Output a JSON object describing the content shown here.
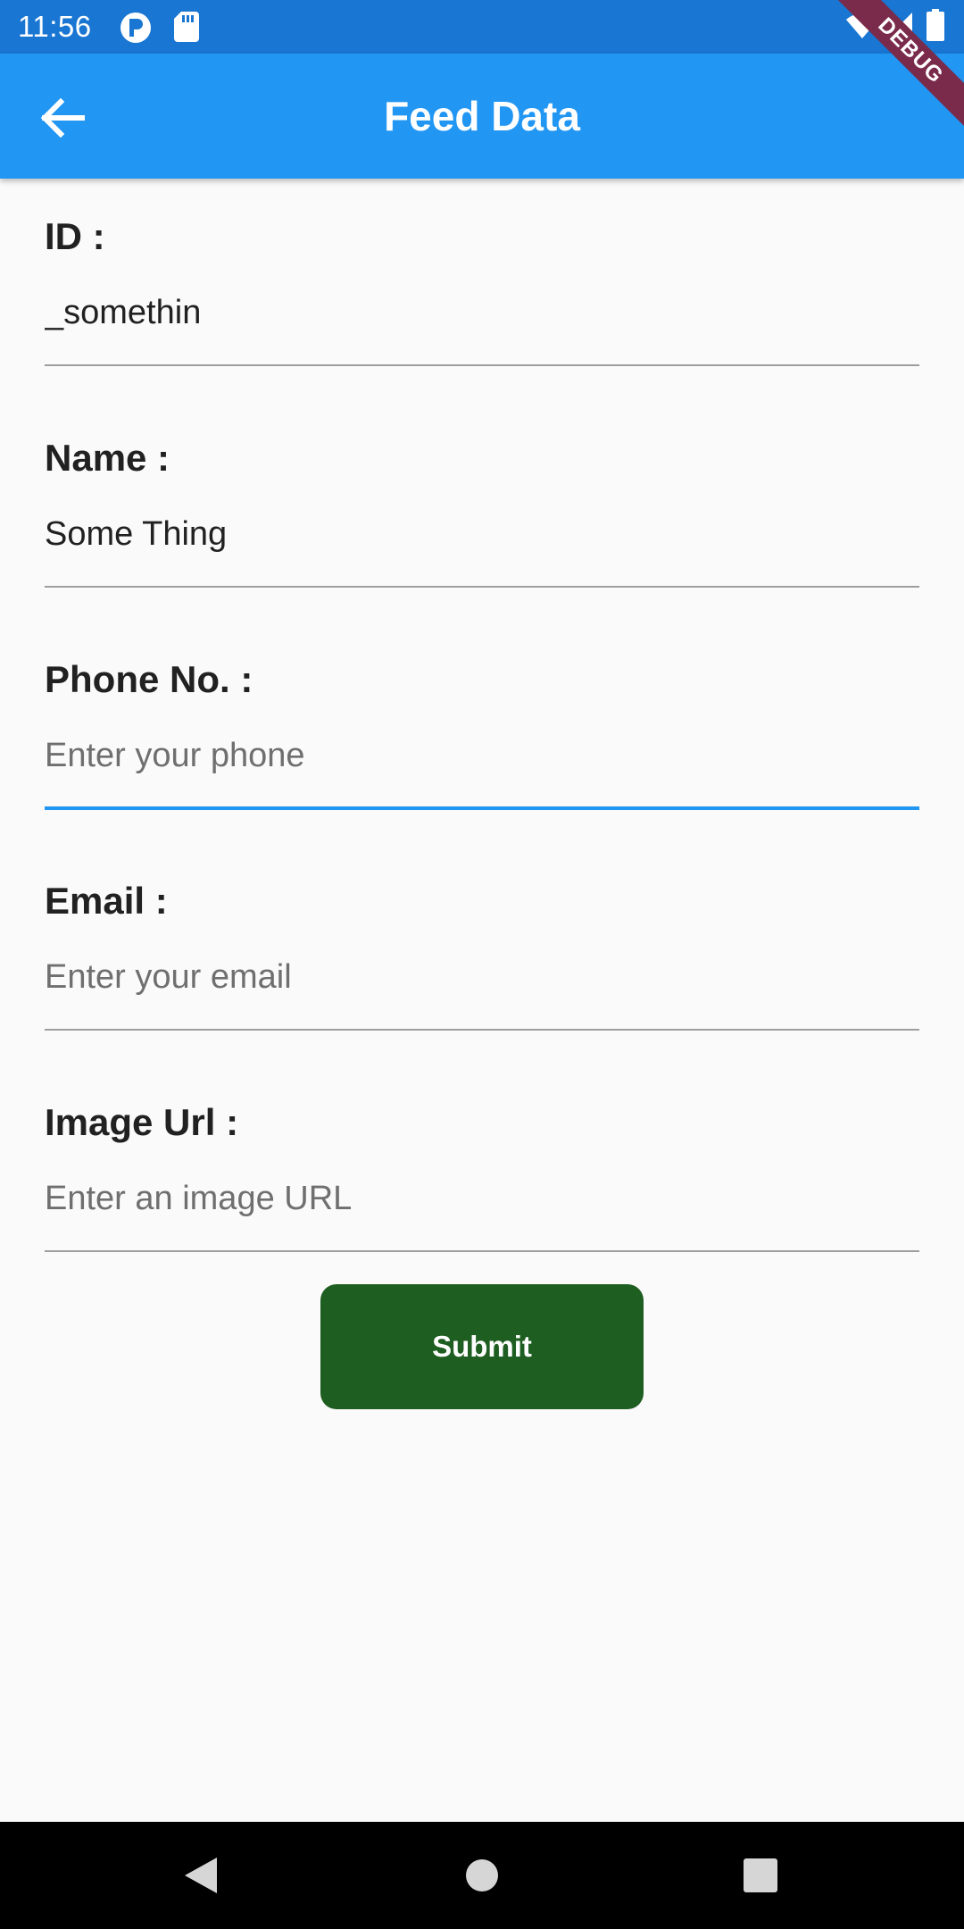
{
  "status_bar": {
    "time": "11:56",
    "icons": [
      "badge-p-icon",
      "sd-card-icon",
      "wifi-icon",
      "signal-icon",
      "battery-icon"
    ]
  },
  "app_bar": {
    "title": "Feed Data",
    "back_icon": "arrow-left-icon",
    "debug_banner": "DEBUG"
  },
  "form": {
    "fields": [
      {
        "label": "ID :",
        "value": "_somethin",
        "placeholder": "",
        "focused": false
      },
      {
        "label": "Name :",
        "value": "Some Thing",
        "placeholder": "",
        "focused": false
      },
      {
        "label": "Phone No. :",
        "value": "",
        "placeholder": "Enter your phone",
        "focused": true
      },
      {
        "label": "Email :",
        "value": "",
        "placeholder": "Enter your email",
        "focused": false
      },
      {
        "label": "Image Url :",
        "value": "",
        "placeholder": "Enter an image URL",
        "focused": false
      }
    ],
    "submit_label": "Submit"
  },
  "nav_bar": {
    "icons": [
      "back-triangle-icon",
      "home-circle-icon",
      "recents-square-icon"
    ]
  },
  "colors": {
    "status_bar": "#1976d2",
    "app_bar": "#2196f3",
    "submit_button": "#1e5e20",
    "focus_underline": "#2196f3",
    "debug_ribbon": "#7a2a4a"
  }
}
